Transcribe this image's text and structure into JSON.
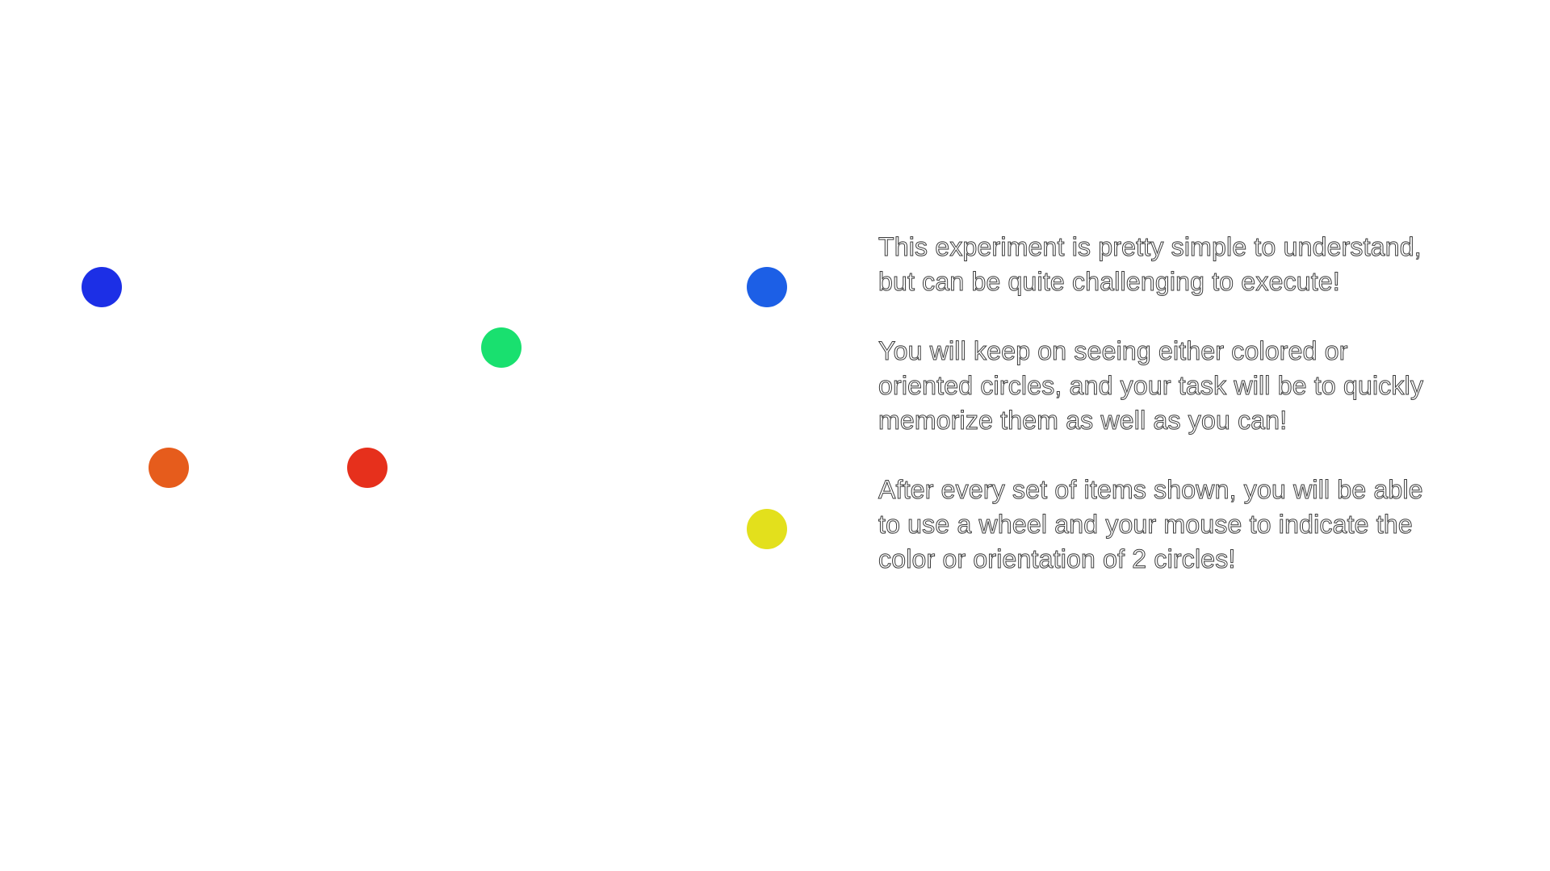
{
  "stimuli": [
    {
      "id": "dot-1",
      "color": "#1c2fe6"
    },
    {
      "id": "dot-2",
      "color": "#19e06f"
    },
    {
      "id": "dot-3",
      "color": "#e65c1c"
    },
    {
      "id": "dot-4",
      "color": "#e6301c"
    },
    {
      "id": "dot-5",
      "color": "#1c5fe6"
    },
    {
      "id": "dot-6",
      "color": "#e3e01c"
    }
  ],
  "instructions": {
    "paragraph_1": "This experiment is pretty simple to understand,\nbut can be quite challenging to execute!",
    "paragraph_2": "You will keep on seeing either colored or\noriented circles, and your task will be to quickly\nmemorize them as well as you can!",
    "paragraph_3": "After every set of items shown, you will be able\nto use a wheel and your mouse to indicate the\ncolor or orientation of 2 circles!"
  }
}
